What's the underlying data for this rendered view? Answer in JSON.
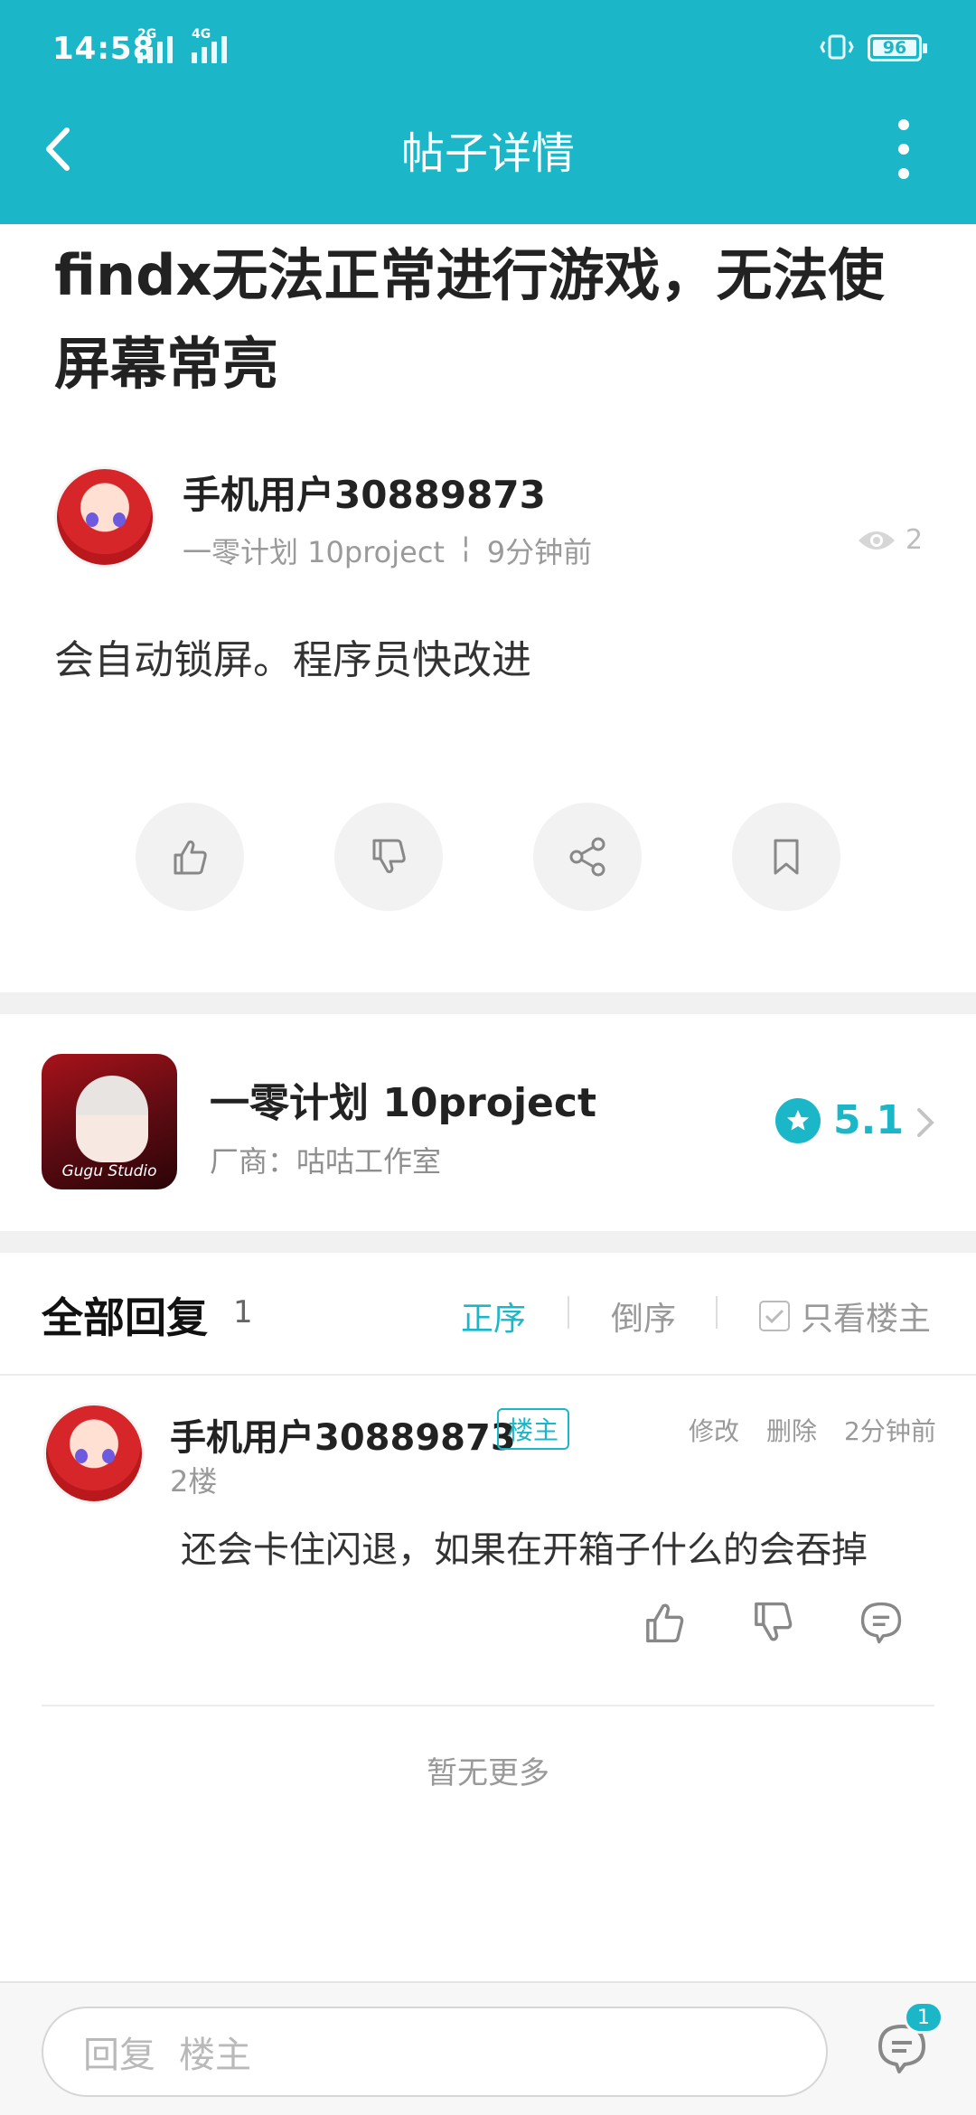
{
  "status_bar": {
    "time": "14:58",
    "sim1_tag": "2G",
    "sim2_tag": "4G",
    "battery": "96"
  },
  "header": {
    "title": "帖子详情"
  },
  "post": {
    "title": "findx无法正常进行游戏，无法使屏幕常亮",
    "author": "手机用户30889873",
    "game_tag": "一零计划 10project",
    "meta_sep": "¦",
    "time_ago": "9分钟前",
    "views": "2",
    "body": "会自动锁屏。程序员快改进"
  },
  "game_card": {
    "name": "一零计划 10project",
    "vendor": "厂商：咕咕工作室",
    "icon_caption": "Gugu Studio",
    "rating": "5.1"
  },
  "replies": {
    "title": "全部回复",
    "count": "1",
    "sort_asc": "正序",
    "sort_desc": "倒序",
    "only_owner": "只看楼主",
    "items": [
      {
        "author": "手机用户30889873",
        "badge": "楼主",
        "edit": "修改",
        "delete": "删除",
        "time_ago": "2分钟前",
        "floor": "2楼",
        "body": "还会卡住闪退，如果在开箱子什么的会吞掉"
      }
    ],
    "no_more": "暂无更多"
  },
  "bottom_bar": {
    "reply_label": "回复",
    "reply_target": "楼主",
    "comment_count": "1"
  },
  "colors": {
    "accent": "#1bb7c9",
    "muted_text": "#999999",
    "page_bg": "#ffffff",
    "band_bg": "#f1f1f1"
  },
  "icons": [
    "back-arrow-icon",
    "more-vertical-icon",
    "eye-icon",
    "thumb-up-icon",
    "thumb-down-icon",
    "share-icon",
    "bookmark-icon",
    "star-icon",
    "chevron-right-icon",
    "checkbox-icon",
    "comment-icon",
    "vibrate-icon",
    "signal-icon",
    "battery-icon"
  ]
}
